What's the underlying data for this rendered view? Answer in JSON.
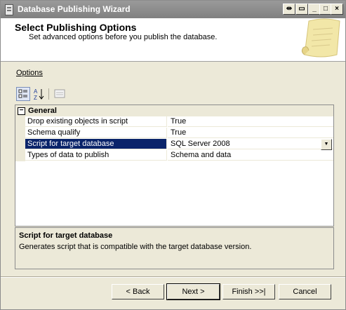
{
  "window": {
    "title": "Database Publishing Wizard"
  },
  "titlebar_buttons": [
    "←|→",
    "▯",
    "_",
    "□",
    "X"
  ],
  "header": {
    "title": "Select Publishing Options",
    "subtitle": "Set advanced options before you publish the database."
  },
  "options_label": "Options",
  "grid": {
    "category": "General",
    "rows": [
      {
        "name": "Drop existing objects in script",
        "value": "True"
      },
      {
        "name": "Schema qualify",
        "value": "True"
      },
      {
        "name": "Script for target database",
        "value": "SQL Server 2008"
      },
      {
        "name": "Types of data to publish",
        "value": "Schema and data"
      }
    ]
  },
  "description": {
    "title": "Script for target database",
    "text": "Generates script that is compatible with the target database version."
  },
  "buttons": {
    "back": "< Back",
    "next": "Next >",
    "finish": "Finish >>|",
    "cancel": "Cancel"
  },
  "colors": {
    "selection": "#0a246a",
    "face": "#ece9d8",
    "title_bar": "#8a8a8a"
  }
}
